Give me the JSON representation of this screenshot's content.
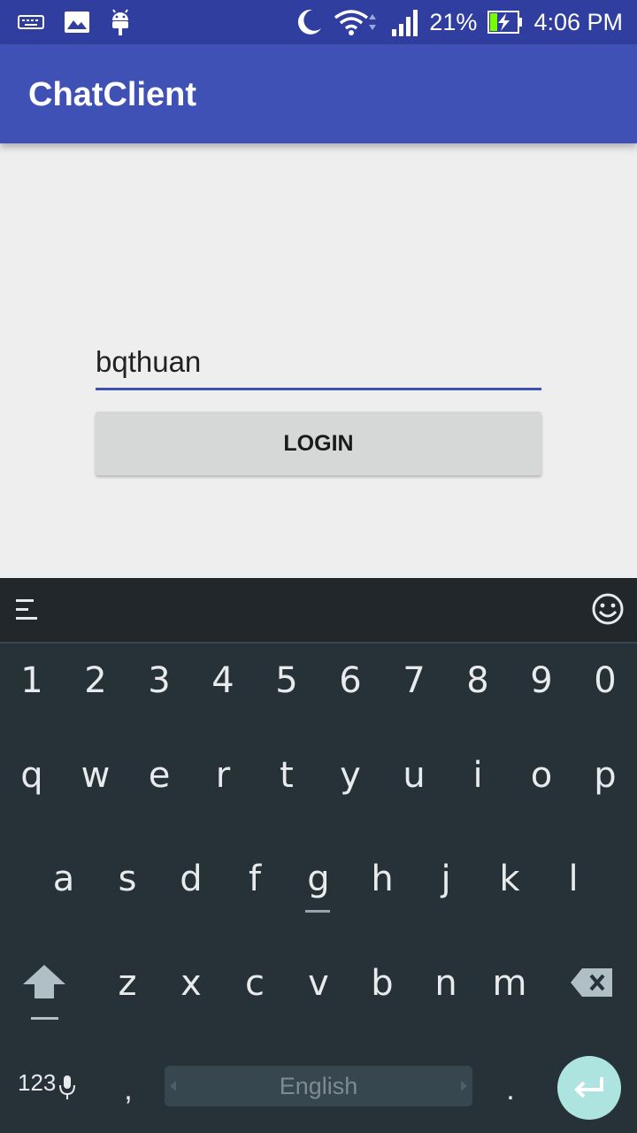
{
  "status_bar": {
    "battery_percent": "21%",
    "time": "4:06 PM",
    "icons": [
      "keyboard-icon",
      "gallery-icon",
      "android-icon",
      "moon-icon",
      "wifi-icon",
      "signal-icon",
      "battery-charging-icon"
    ]
  },
  "app_bar": {
    "title": "ChatClient"
  },
  "form": {
    "username_value": "bqthuan",
    "login_label": "LOGIN"
  },
  "keyboard": {
    "number_row": [
      "1",
      "2",
      "3",
      "4",
      "5",
      "6",
      "7",
      "8",
      "9",
      "0"
    ],
    "row1": [
      "q",
      "w",
      "e",
      "r",
      "t",
      "y",
      "u",
      "i",
      "o",
      "p"
    ],
    "row2": [
      "a",
      "s",
      "d",
      "f",
      "g",
      "h",
      "j",
      "k",
      "l"
    ],
    "row3": [
      "z",
      "x",
      "c",
      "v",
      "b",
      "n",
      "m"
    ],
    "symbols_key": "123",
    "comma_key": ",",
    "space_label": "English",
    "period_key": "."
  },
  "colors": {
    "status_bar": "#303f9f",
    "app_bar": "#3f51b5",
    "keyboard": "#263238",
    "enter_key": "#aee4e0"
  }
}
